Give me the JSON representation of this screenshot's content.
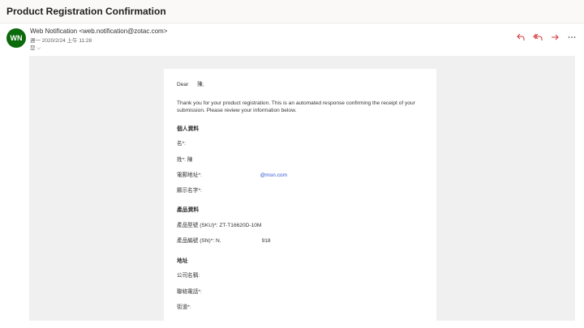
{
  "subject": "Product Registration Confirmation",
  "sender": {
    "initials": "WN",
    "display": "Web Notification <web.notification@zotac.com>",
    "date": "週一 2020/2/24 上午 11:28",
    "to_label": "您 ⌵"
  },
  "actions": [
    {
      "name": "reply",
      "icon": "reply-icon",
      "color": "#d13438"
    },
    {
      "name": "reply-all",
      "icon": "reply-all-icon",
      "color": "#d13438"
    },
    {
      "name": "forward",
      "icon": "forward-icon",
      "color": "#d13438"
    },
    {
      "name": "more",
      "icon": "more-icon",
      "color": "#605e5c"
    }
  ],
  "email": {
    "greeting": "Dear      陳,",
    "intro": "Thank you for your product registration. This is an automated response confirming the receipt of your submission. Please review your information below.",
    "personal": {
      "title": "個人資料",
      "first_name": "名*: ",
      "last_name": "姓*: 陳",
      "email_label": "電郵地址*: ",
      "email_value": "@msn.com",
      "display_name": "顯示名字*: "
    },
    "product": {
      "title": "產品資料",
      "sku": "產品型號 (SKU)*: ZT-T16620D-10M",
      "sn_label": "產品編號 (SN)*: N.",
      "sn_tail": "918"
    },
    "address": {
      "title": "地址",
      "company": "公司名稱: ",
      "phone": "聯絡電話*: ",
      "street": "街道*: "
    }
  },
  "colors": {
    "avatar": "#0b6a0b",
    "accent_actions": "#d13438",
    "link": "#2b55d8"
  }
}
